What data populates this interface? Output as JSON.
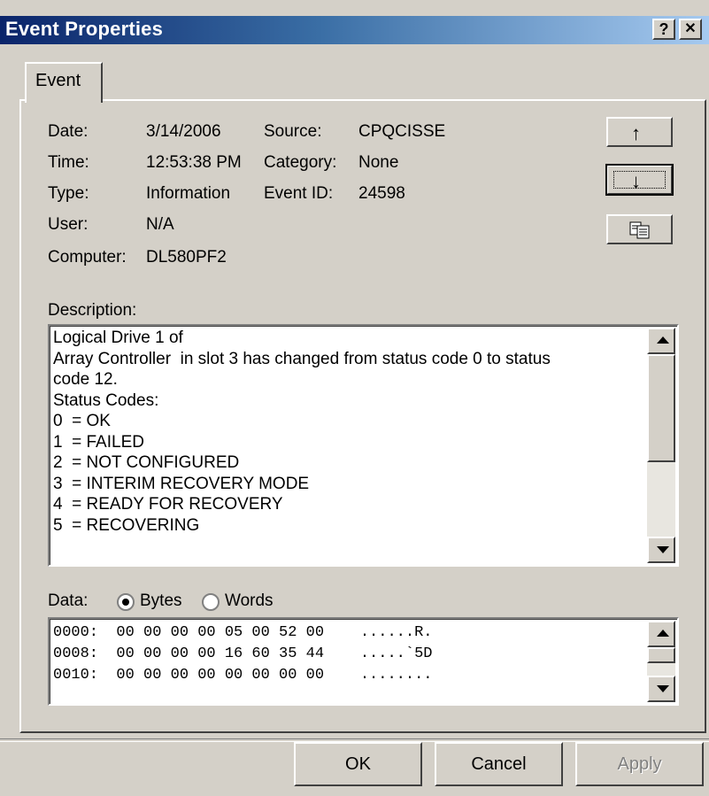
{
  "window": {
    "title": "Event Properties",
    "help_label": "?",
    "close_label": "✕"
  },
  "tabs": [
    {
      "label": "Event"
    }
  ],
  "fields": {
    "date_label": "Date:",
    "date_value": "3/14/2006",
    "time_label": "Time:",
    "time_value": "12:53:38 PM",
    "type_label": "Type:",
    "type_value": "Information",
    "user_label": "User:",
    "user_value": "N/A",
    "computer_label": "Computer:",
    "computer_value": "DL580PF2",
    "source_label": "Source:",
    "source_value": "CPQCISSE",
    "category_label": "Category:",
    "category_value": "None",
    "eventid_label": "Event ID:",
    "eventid_value": "24598"
  },
  "side_buttons": {
    "up_icon": "up-arrow-icon",
    "down_icon": "down-arrow-icon",
    "copy_icon": "copy-icon"
  },
  "description": {
    "label": "Description:",
    "text": "Logical Drive 1 of\nArray Controller  in slot 3 has changed from status code 0 to status\ncode 12.\nStatus Codes:\n0  = OK\n1  = FAILED\n2  = NOT CONFIGURED\n3  = INTERIM RECOVERY MODE\n4  = READY FOR RECOVERY\n5  = RECOVERING"
  },
  "data_section": {
    "label": "Data:",
    "bytes_label": "Bytes",
    "words_label": "Words",
    "selected": "Bytes",
    "rows": [
      "0000:  00 00 00 00 05 00 52 00    ......R.",
      "0008:  00 00 00 00 16 60 35 44    .....`5D",
      "0010:  00 00 00 00 00 00 00 00    ........"
    ]
  },
  "buttons": {
    "ok": "OK",
    "cancel": "Cancel",
    "apply": "Apply"
  },
  "colors": {
    "titlebar_start": "#0a246a",
    "titlebar_end": "#a6caf0",
    "face": "#d4d0c8"
  }
}
